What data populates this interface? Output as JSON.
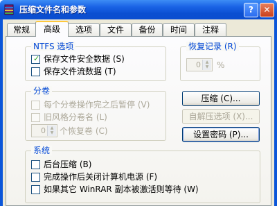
{
  "window": {
    "title": "压缩文件名和参数",
    "help_label": "?",
    "close_label": "✕"
  },
  "tabs": [
    {
      "label": "常规"
    },
    {
      "label": "高级"
    },
    {
      "label": "选项"
    },
    {
      "label": "文件"
    },
    {
      "label": "备份"
    },
    {
      "label": "时间"
    },
    {
      "label": "注释"
    }
  ],
  "ntfs": {
    "title": "NTFS 选项",
    "save_security": "保存文件安全数据 (S)",
    "save_streams": "保存文件流数据 (T)"
  },
  "recovery": {
    "title": "恢复记录 (R)",
    "value": "0",
    "unit": "%"
  },
  "volumes": {
    "title": "分卷",
    "pause_after_volume": "每个分卷操作完之后暂停 (V)",
    "old_style_naming": "旧风格分卷名 (L)",
    "recovery_volumes_value": "0",
    "recovery_volumes_label": "个恢复卷 (C)"
  },
  "buttons": {
    "compression": "压缩 (C)...",
    "sfx_options": "自解压选项 (X)...",
    "set_password": "设置密码 (P)..."
  },
  "system": {
    "title": "系统",
    "background": "后台压缩 (B)",
    "shutdown_when_done": "完成操作后关闭计算机电源 (F)",
    "wait_if_busy": "如果其它 WinRAR 副本被激活则等待 (W)"
  },
  "colors": {
    "group_title": "#0046d5",
    "tab_highlight": "#ffc83c",
    "titlebar": "#0b4fd1"
  }
}
